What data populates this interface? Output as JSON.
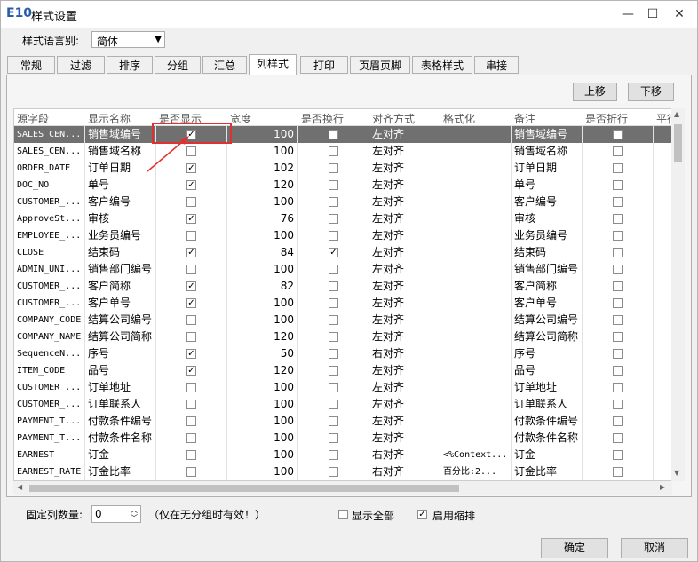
{
  "window": {
    "logo": "E10",
    "title": "样式设置",
    "min": "—",
    "max": "☐",
    "close": "✕"
  },
  "lang": {
    "label": "样式语言别:",
    "value": "简体"
  },
  "tabs": [
    "常规",
    "过滤",
    "排序",
    "分组",
    "汇总",
    "列样式",
    "打印",
    "页眉页脚",
    "表格样式",
    "串接"
  ],
  "active_tab": "列样式",
  "buttons": {
    "up": "上移",
    "down": "下移",
    "ok": "确定",
    "cancel": "取消"
  },
  "columns": [
    "源字段",
    "显示名称",
    "是否显示",
    "宽度",
    "是否换行",
    "对齐方式",
    "格式化",
    "备注",
    "是否折行",
    "平行"
  ],
  "rows": [
    {
      "src": "SALES_CEN...",
      "name": "销售域编号",
      "show": true,
      "width": "100",
      "wrap": false,
      "align": "左对齐",
      "fmt": "",
      "note": "销售域编号",
      "fold": false
    },
    {
      "src": "SALES_CEN...",
      "name": "销售域名称",
      "show": false,
      "width": "100",
      "wrap": false,
      "align": "左对齐",
      "fmt": "",
      "note": "销售域名称",
      "fold": false
    },
    {
      "src": "ORDER_DATE",
      "name": "订单日期",
      "show": true,
      "width": "102",
      "wrap": false,
      "align": "左对齐",
      "fmt": "",
      "note": "订单日期",
      "fold": false
    },
    {
      "src": "DOC_NO",
      "name": "单号",
      "show": true,
      "width": "120",
      "wrap": false,
      "align": "左对齐",
      "fmt": "",
      "note": "单号",
      "fold": false
    },
    {
      "src": "CUSTOMER_...",
      "name": "客户编号",
      "show": false,
      "width": "100",
      "wrap": false,
      "align": "左对齐",
      "fmt": "",
      "note": "客户编号",
      "fold": false
    },
    {
      "src": "ApproveSt...",
      "name": "审核",
      "show": true,
      "width": "76",
      "wrap": false,
      "align": "左对齐",
      "fmt": "",
      "note": "审核",
      "fold": false
    },
    {
      "src": "EMPLOYEE_...",
      "name": "业务员编号",
      "show": false,
      "width": "100",
      "wrap": false,
      "align": "左对齐",
      "fmt": "",
      "note": "业务员编号",
      "fold": false
    },
    {
      "src": "CLOSE",
      "name": "结束码",
      "show": true,
      "width": "84",
      "wrap": true,
      "align": "左对齐",
      "fmt": "",
      "note": "结束码",
      "fold": false
    },
    {
      "src": "ADMIN_UNI...",
      "name": "销售部门编号",
      "show": false,
      "width": "100",
      "wrap": false,
      "align": "左对齐",
      "fmt": "",
      "note": "销售部门编号",
      "fold": false
    },
    {
      "src": "CUSTOMER_...",
      "name": "客户简称",
      "show": true,
      "width": "82",
      "wrap": false,
      "align": "左对齐",
      "fmt": "",
      "note": "客户简称",
      "fold": false
    },
    {
      "src": "CUSTOMER_...",
      "name": "客户单号",
      "show": true,
      "width": "100",
      "wrap": false,
      "align": "左对齐",
      "fmt": "",
      "note": "客户单号",
      "fold": false
    },
    {
      "src": "COMPANY_CODE",
      "name": "结算公司编号",
      "show": false,
      "width": "100",
      "wrap": false,
      "align": "左对齐",
      "fmt": "",
      "note": "结算公司编号",
      "fold": false
    },
    {
      "src": "COMPANY_NAME",
      "name": "结算公司简称",
      "show": false,
      "width": "120",
      "wrap": false,
      "align": "左对齐",
      "fmt": "",
      "note": "结算公司简称",
      "fold": false
    },
    {
      "src": "SequenceN...",
      "name": "序号",
      "show": true,
      "width": "50",
      "wrap": false,
      "align": "右对齐",
      "fmt": "",
      "note": "序号",
      "fold": false
    },
    {
      "src": "ITEM_CODE",
      "name": "品号",
      "show": true,
      "width": "120",
      "wrap": false,
      "align": "左对齐",
      "fmt": "",
      "note": "品号",
      "fold": false
    },
    {
      "src": "CUSTOMER_...",
      "name": "订单地址",
      "show": false,
      "width": "100",
      "wrap": false,
      "align": "左对齐",
      "fmt": "",
      "note": "订单地址",
      "fold": false
    },
    {
      "src": "CUSTOMER_...",
      "name": "订单联系人",
      "show": false,
      "width": "100",
      "wrap": false,
      "align": "左对齐",
      "fmt": "",
      "note": "订单联系人",
      "fold": false
    },
    {
      "src": "PAYMENT_T...",
      "name": "付款条件编号",
      "show": false,
      "width": "100",
      "wrap": false,
      "align": "左对齐",
      "fmt": "",
      "note": "付款条件编号",
      "fold": false
    },
    {
      "src": "PAYMENT_T...",
      "name": "付款条件名称",
      "show": false,
      "width": "100",
      "wrap": false,
      "align": "左对齐",
      "fmt": "",
      "note": "付款条件名称",
      "fold": false
    },
    {
      "src": "EARNEST",
      "name": "订金",
      "show": false,
      "width": "100",
      "wrap": false,
      "align": "右对齐",
      "fmt": "<%Context...",
      "note": "订金",
      "fold": false
    },
    {
      "src": "EARNEST_RATE",
      "name": "订金比率",
      "show": false,
      "width": "100",
      "wrap": false,
      "align": "右对齐",
      "fmt": "百分比:2...",
      "note": "订金比率",
      "fold": false
    }
  ],
  "fixed": {
    "label": "固定列数量:",
    "value": "0",
    "hint": "（仅在无分组时有效！）"
  },
  "options": {
    "show_all": "显示全部",
    "enable_shrink": "启用缩排"
  }
}
